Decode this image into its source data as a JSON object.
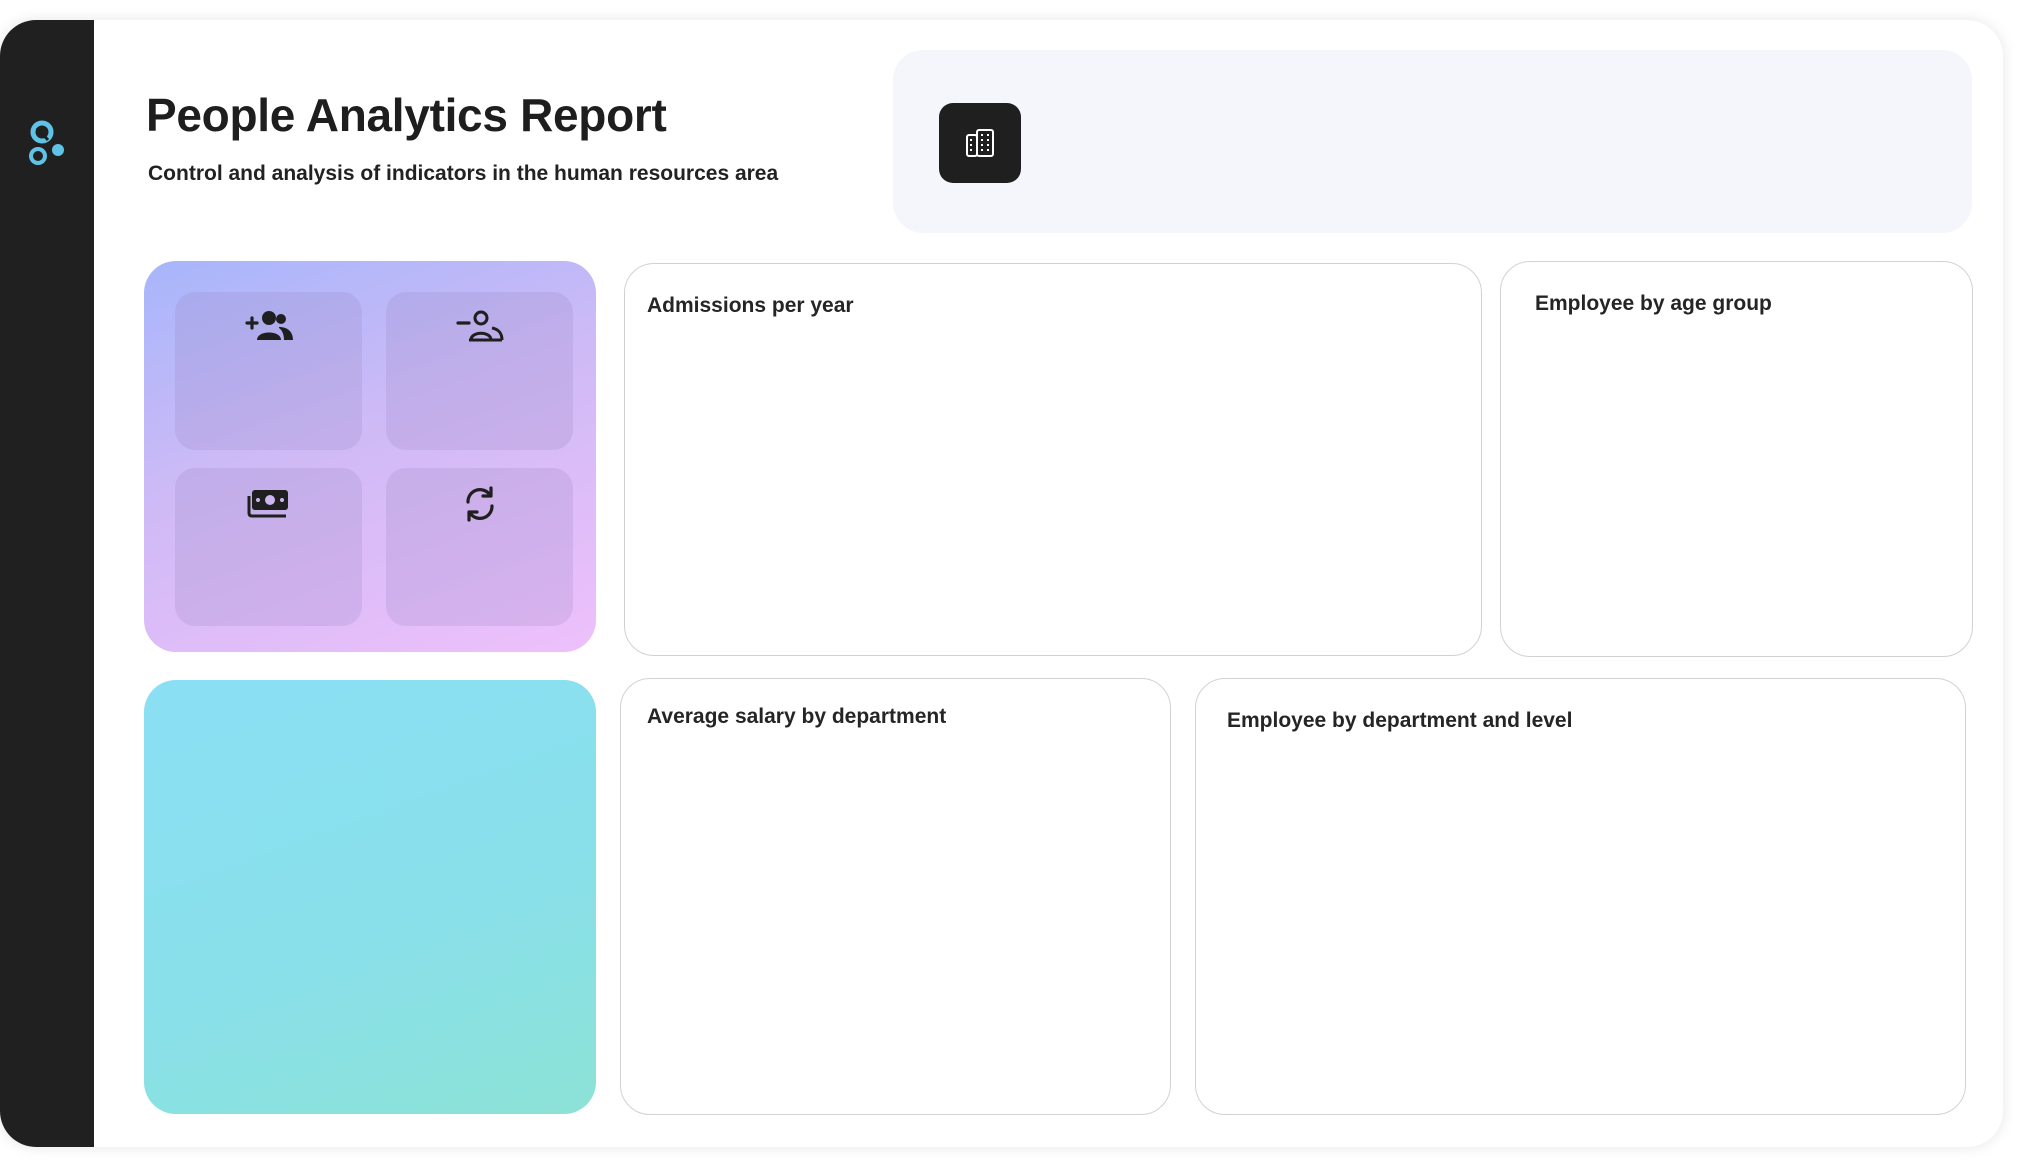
{
  "header": {
    "title": "People Analytics Report",
    "subtitle": "Control and analysis of indicators in the human resources area"
  },
  "sidebar": {
    "logo": "app-logo-icon"
  },
  "filters": {
    "button_icon": "building-icon"
  },
  "kpi_tiles": [
    {
      "icon": "add-user-icon"
    },
    {
      "icon": "remove-user-icon"
    },
    {
      "icon": "money-icon"
    },
    {
      "icon": "refresh-icon"
    }
  ],
  "charts": {
    "admissions": {
      "title": "Admissions per year"
    },
    "age_group": {
      "title": "Employee by age group"
    },
    "salary": {
      "title": "Average salary by department"
    },
    "dept_level": {
      "title": "Employee by department and level"
    }
  },
  "colors": {
    "sidebar": "#202020",
    "accent": "#5fc3e8",
    "kpi_gradient_start": "#a7b6fb",
    "kpi_gradient_end": "#eec0fb",
    "cyan_gradient_start": "#8adff4",
    "cyan_gradient_end": "#8ce2d6",
    "filter_panel": "#f4f6fb"
  }
}
